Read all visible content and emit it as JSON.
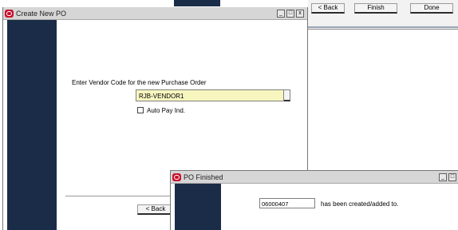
{
  "background_wizard": {
    "buttons": {
      "back": "< Back",
      "finish": "Finish",
      "done": "Done"
    }
  },
  "create_po_window": {
    "title": "Create New PO",
    "controls": {
      "minimize": "_",
      "maximize": "□",
      "close": "x"
    },
    "prompt": "Enter Vendor Code for the new Purchase Order",
    "vendor_code": "RJB-VENDOR1",
    "auto_pay_label": "Auto Pay Ind.",
    "auto_pay_checked": false,
    "back_button": "< Back"
  },
  "po_finished_window": {
    "title": "PO Finished",
    "controls": {
      "minimize": "_",
      "maximize": "□"
    },
    "po_number": "06000407",
    "message": "has been created/added to."
  },
  "colors": {
    "navy_panel": "#1b2c48",
    "titlebar": "#d6d6d6",
    "input_yellow": "#f7f6bf",
    "oracle_red": "#c8102e"
  }
}
